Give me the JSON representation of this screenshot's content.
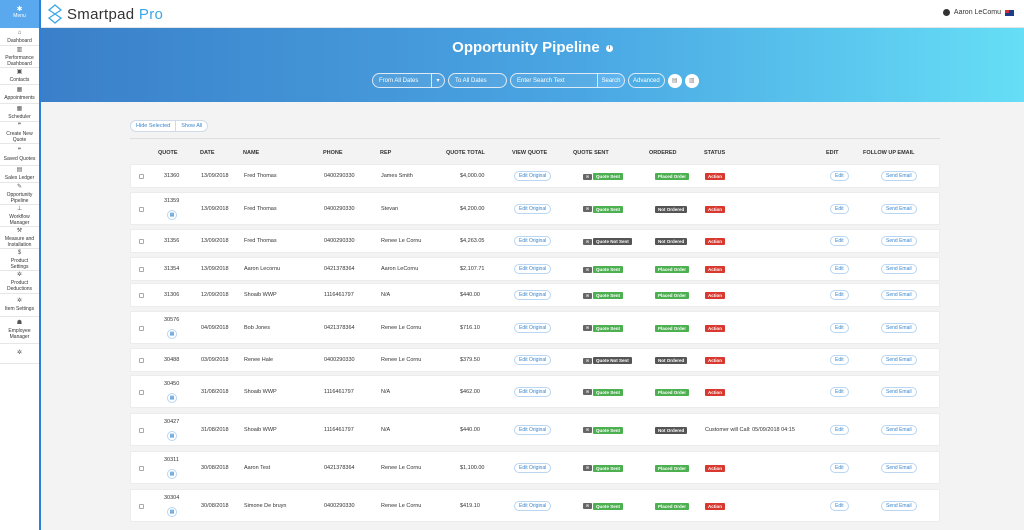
{
  "sidebar": {
    "menu_label": "Menu",
    "items": [
      {
        "label": "Dashboard",
        "icon": "home-icon"
      },
      {
        "label": "Performance Dashboard",
        "icon": "bar-chart-icon"
      },
      {
        "label": "Contacts",
        "icon": "contacts-icon"
      },
      {
        "label": "Appointments",
        "icon": "calendar-icon"
      },
      {
        "label": "Scheduler",
        "icon": "calendar-check-icon"
      },
      {
        "label": "Create New Quote",
        "icon": "quote-icon"
      },
      {
        "label": "Saved Quotes",
        "icon": "quote-icon"
      },
      {
        "label": "Sales Ledger",
        "icon": "ledger-icon"
      },
      {
        "label": "Opportunity Pipeline",
        "icon": "edit-icon"
      },
      {
        "label": "Workflow Manager",
        "icon": "sitemap-icon"
      },
      {
        "label": "Measure and Installation",
        "icon": "wrench-icon"
      },
      {
        "label": "Product Settings",
        "icon": "dollar-icon"
      },
      {
        "label": "Product Deductions",
        "icon": "gear-icon"
      },
      {
        "label": "Item Settings",
        "icon": "gear-icon"
      },
      {
        "label": "Employee Manager",
        "icon": "users-icon"
      },
      {
        "label": "",
        "icon": "gear-icon"
      }
    ]
  },
  "topbar": {
    "logo_main": "Smartpad",
    "logo_accent": "Pro",
    "user_name": "Aaron LeComu"
  },
  "banner": {
    "title": "Opportunity Pipeline",
    "from_dates": "From All Dates",
    "to_dates": "To All Dates",
    "search_placeholder": "Enter Search Text",
    "search_button": "Search",
    "advanced_button": "Advanced"
  },
  "toggles": {
    "hide_selected": "Hide Selected",
    "show_all": "Show All"
  },
  "table": {
    "headers": {
      "quote": "QUOTE",
      "date": "DATE",
      "name": "NAME",
      "phone": "PHONE",
      "rep": "REP",
      "total": "QUOTE TOTAL",
      "view": "VIEW QUOTE",
      "sent": "QUOTE SENT",
      "ordered": "ORDERED",
      "status": "STATUS",
      "edit": "EDIT",
      "follow": "FOLLOW UP EMAIL"
    },
    "labels": {
      "edit_original": "Edit Original",
      "edit": "Edit",
      "send_email": "Send Email"
    },
    "rows": [
      {
        "quote": "31360",
        "date": "13/09/2018",
        "name": "Fred Thomas",
        "phone": "0400290330",
        "rep": "James Smith",
        "total": "$4,000.00",
        "sent": "Quote Sent",
        "sent_ok": true,
        "ordered": "Placed Order",
        "ordered_ok": true,
        "status": "Action",
        "status_text": "",
        "cal": false
      },
      {
        "quote": "31359",
        "date": "13/09/2018",
        "name": "Fred Thomas",
        "phone": "0400290330",
        "rep": "Stevan",
        "total": "$4,200.00",
        "sent": "Quote Sent",
        "sent_ok": true,
        "ordered": "Not Ordered",
        "ordered_ok": false,
        "status": "Action",
        "status_text": "",
        "cal": true
      },
      {
        "quote": "31356",
        "date": "13/09/2018",
        "name": "Fred Thomas",
        "phone": "0400290330",
        "rep": "Renee Le Cornu",
        "total": "$4,263.05",
        "sent": "Quote Not Sent",
        "sent_ok": false,
        "ordered": "Not Ordered",
        "ordered_ok": false,
        "status": "Action",
        "status_text": "",
        "cal": false
      },
      {
        "quote": "31354",
        "date": "13/09/2018",
        "name": "Aaron Lecornu",
        "phone": "0421378364",
        "rep": "Aaron LeCornu",
        "total": "$2,107.71",
        "sent": "Quote Sent",
        "sent_ok": true,
        "ordered": "Placed Order",
        "ordered_ok": true,
        "status": "Action",
        "status_text": "",
        "cal": false
      },
      {
        "quote": "31306",
        "date": "12/09/2018",
        "name": "Shoaib WWP",
        "phone": "1116461797",
        "rep": "N/A",
        "total": "$440.00",
        "sent": "Quote Sent",
        "sent_ok": true,
        "ordered": "Placed Order",
        "ordered_ok": true,
        "status": "Action",
        "status_text": "",
        "cal": false
      },
      {
        "quote": "30576",
        "date": "04/09/2018",
        "name": "Bob Jones",
        "phone": "0421378364",
        "rep": "Renee Le Cornu",
        "total": "$716.10",
        "sent": "Quote Sent",
        "sent_ok": true,
        "ordered": "Placed Order",
        "ordered_ok": true,
        "status": "Action",
        "status_text": "",
        "cal": true
      },
      {
        "quote": "30488",
        "date": "03/09/2018",
        "name": "Renee Hale",
        "phone": "0400290330",
        "rep": "Renee Le Cornu",
        "total": "$379.50",
        "sent": "Quote Not Sent",
        "sent_ok": false,
        "ordered": "Not Ordered",
        "ordered_ok": false,
        "status": "Action",
        "status_text": "",
        "cal": false
      },
      {
        "quote": "30450",
        "date": "31/08/2018",
        "name": "Shoaib WWP",
        "phone": "1116461797",
        "rep": "N/A",
        "total": "$462.00",
        "sent": "Quote Sent",
        "sent_ok": true,
        "ordered": "Placed Order",
        "ordered_ok": true,
        "status": "Action",
        "status_text": "",
        "cal": true
      },
      {
        "quote": "30427",
        "date": "31/08/2018",
        "name": "Shoaib WWP",
        "phone": "1116461797",
        "rep": "N/A",
        "total": "$440.00",
        "sent": "Quote Sent",
        "sent_ok": true,
        "ordered": "Not Ordered",
        "ordered_ok": false,
        "status": "",
        "status_text": "Customer will Call: 05/09/2018 04:15",
        "cal": true
      },
      {
        "quote": "30311",
        "date": "30/08/2018",
        "name": "Aaron Test",
        "phone": "0421378364",
        "rep": "Renee Le Cornu",
        "total": "$1,100.00",
        "sent": "Quote Sent",
        "sent_ok": true,
        "ordered": "Placed Order",
        "ordered_ok": true,
        "status": "Action",
        "status_text": "",
        "cal": true
      },
      {
        "quote": "30304",
        "date": "30/08/2018",
        "name": "Simone De bruyn",
        "phone": "0400290330",
        "rep": "Renee Le Cornu",
        "total": "$419.10",
        "sent": "Quote Sent",
        "sent_ok": true,
        "ordered": "Placed Order",
        "ordered_ok": true,
        "status": "Action",
        "status_text": "",
        "cal": true
      }
    ]
  },
  "colors": {
    "accent": "#3a87cf",
    "success": "#4caf50",
    "danger": "#d9382f",
    "neutral": "#555555"
  }
}
